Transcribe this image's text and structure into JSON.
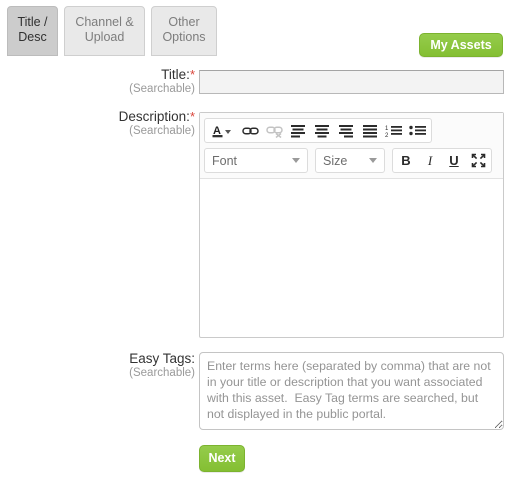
{
  "tabs": [
    {
      "name": "tab-title-desc",
      "line1": "Title /",
      "line2": "Desc",
      "active": true
    },
    {
      "name": "tab-channel-upload",
      "line1": "Channel &",
      "line2": "Upload",
      "active": false
    },
    {
      "name": "tab-other-options",
      "line1": "Other",
      "line2": "Options",
      "active": false
    }
  ],
  "header": {
    "my_assets_label": "My Assets"
  },
  "fields": {
    "title": {
      "label": "Title:",
      "required_marker": "*",
      "sublabel": "(Searchable)",
      "value": "",
      "placeholder": ""
    },
    "description": {
      "label": "Description:",
      "required_marker": "*",
      "sublabel": "(Searchable)",
      "body_text": ""
    },
    "easy_tags": {
      "label": "Easy Tags:",
      "sublabel": "(Searchable)",
      "value": "",
      "placeholder": "Enter terms here (separated by comma) that are not in your title or description that you want associated with this asset.  Easy Tag terms are searched, but not displayed in the public portal."
    }
  },
  "editor_toolbar": {
    "row1": [
      {
        "name": "text-color-icon",
        "glyph": "A",
        "type": "color",
        "disabled": false
      },
      {
        "name": "link-icon",
        "glyph": "link",
        "type": "icon",
        "disabled": false
      },
      {
        "name": "unlink-icon",
        "glyph": "unlink",
        "type": "icon",
        "disabled": true
      },
      {
        "name": "align-left-icon",
        "glyph": "align-left",
        "type": "icon",
        "disabled": false
      },
      {
        "name": "align-center-icon",
        "glyph": "align-center",
        "type": "icon",
        "disabled": false
      },
      {
        "name": "align-right-icon",
        "glyph": "align-right",
        "type": "icon",
        "disabled": false
      },
      {
        "name": "align-justify-icon",
        "glyph": "align-justify",
        "type": "icon",
        "disabled": false
      },
      {
        "name": "numbered-list-icon",
        "glyph": "ordered-list",
        "type": "icon",
        "disabled": false
      },
      {
        "name": "bulleted-list-icon",
        "glyph": "unordered-list",
        "type": "icon",
        "disabled": false
      }
    ],
    "font_select_label": "Font",
    "size_select_label": "Size",
    "bold_label": "B",
    "italic_label": "I",
    "underline_label": "U",
    "maximize_name": "maximize-icon"
  },
  "footer": {
    "next_label": "Next"
  },
  "colors": {
    "accent_green": "#8dc63f",
    "required_red": "#d9453b",
    "active_tab": "#cccccc",
    "inactive_tab": "#e9e9e9",
    "sublabel_gray": "#9a9a9a"
  }
}
